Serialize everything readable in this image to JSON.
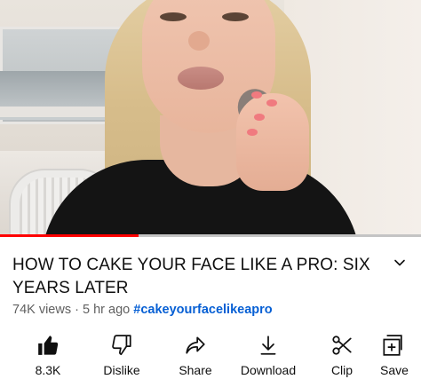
{
  "video": {
    "progress_percent": 33
  },
  "title": "HOW TO CAKE YOUR FACE LIKE A PRO: SIX YEARS LATER",
  "meta": {
    "views": "74K views",
    "separator": "·",
    "age": "5 hr ago",
    "hashtag": "#cakeyourfacelikeapro"
  },
  "actions": [
    {
      "label": "8.3K",
      "icon": "thumbs-up-filled-icon"
    },
    {
      "label": "Dislike",
      "icon": "thumbs-down-outline-icon"
    },
    {
      "label": "Share",
      "icon": "share-arrow-icon"
    },
    {
      "label": "Download",
      "icon": "download-icon"
    },
    {
      "label": "Clip",
      "icon": "scissors-icon"
    },
    {
      "label": "Save",
      "icon": "add-to-playlist-icon"
    }
  ],
  "colors": {
    "progress": "#ff0000",
    "hashtag": "#065fd4",
    "secondary_text": "#606060"
  }
}
